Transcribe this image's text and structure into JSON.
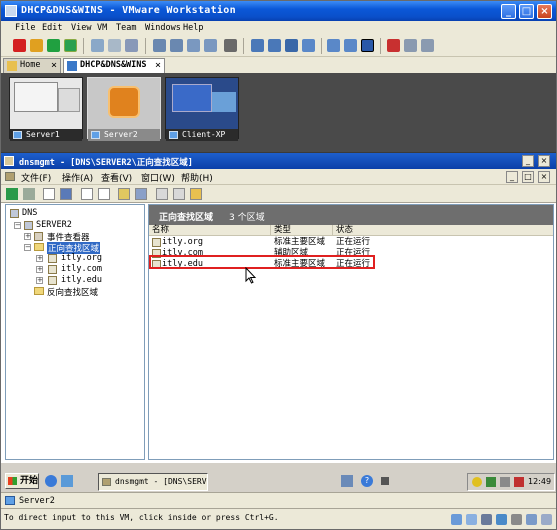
{
  "window": {
    "title": "DHCP&DNS&WINS - VMware Workstation",
    "controls": {
      "minimize": "_",
      "maximize": "□",
      "close": "×"
    }
  },
  "menubar": [
    "File",
    "Edit",
    "View",
    "VM",
    "Team",
    "Windows",
    "Help"
  ],
  "tabs": [
    {
      "label": "Home",
      "close": "×"
    },
    {
      "label": "DHCP&DNS&WINS",
      "close": "×"
    }
  ],
  "thumbnails": [
    {
      "label": "Server1"
    },
    {
      "label": "Server2"
    },
    {
      "label": "Client-XP"
    }
  ],
  "mmc": {
    "title": "dnsmgmt - [DNS\\SERVER2\\正向查找区域]",
    "menu": [
      "文件(F)",
      "操作(A)",
      "查看(V)",
      "窗口(W)",
      "帮助(H)"
    ],
    "tree": {
      "root": "DNS",
      "server": "SERVER2",
      "event_viewer": "事件查看器",
      "forward_zones": "正向查找区域",
      "zones": [
        "itly.org",
        "itly.com",
        "itly.edu"
      ],
      "reverse_zones": "反向查找区域"
    },
    "pane_header": {
      "title": "正向查找区域",
      "count": "3 个区域"
    },
    "columns": [
      "名称",
      "类型",
      "状态"
    ],
    "rows": [
      {
        "name": "itly.org",
        "type": "标准主要区域",
        "status": "正在运行"
      },
      {
        "name": "itly.com",
        "type": "辅助区域",
        "status": "正在运行"
      },
      {
        "name": "itly.edu",
        "type": "标准主要区域",
        "status": "正在运行"
      }
    ]
  },
  "guest_taskbar": {
    "start": "开始",
    "task_item": "dnsmgmt - [DNS\\SERV...",
    "clock": "12:49"
  },
  "vm_name": "Server2",
  "status_text": "To direct input to this VM, click inside or press Ctrl+G.",
  "colors": {
    "title_blue": "#0a4fc9",
    "selection": "#316ac5",
    "highlight_box": "#e02020",
    "chrome": "#ece9d8"
  }
}
